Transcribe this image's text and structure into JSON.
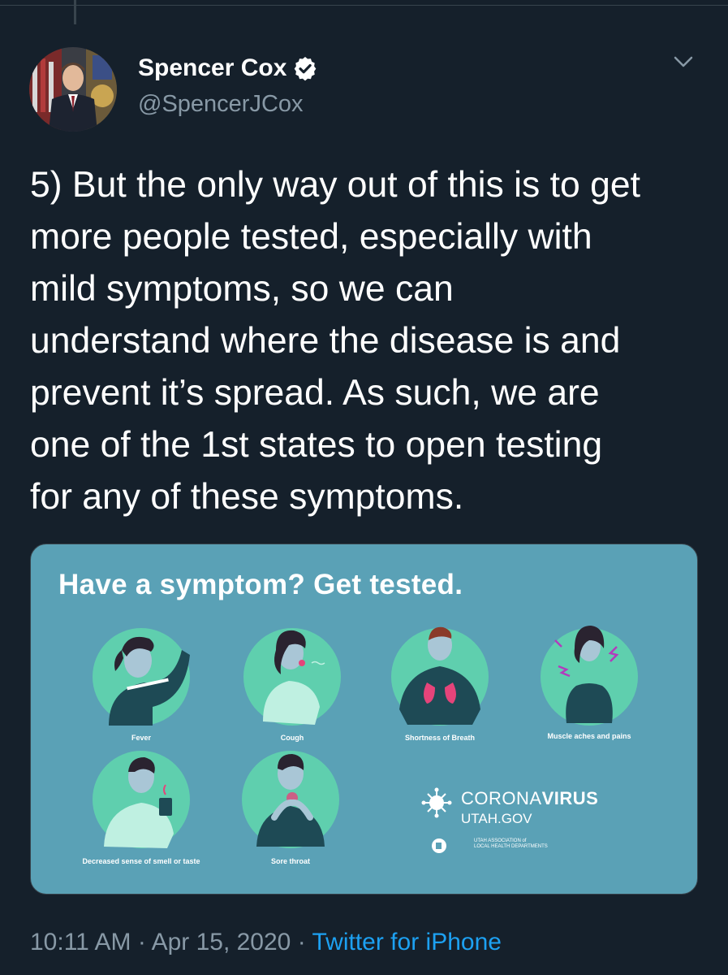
{
  "author": {
    "display_name": "Spencer Cox",
    "handle": "@SpencerJCox",
    "avatar": "avatar-photo",
    "verified_icon": "verified-badge-icon"
  },
  "tweet": {
    "lines": [
      "5) But the only way out of this is to get",
      "more people tested, especially with",
      "mild symptoms, so we can",
      "understand where the disease is and",
      "prevent it’s spread. As such, we are",
      "one of the 1st states to open testing",
      "for any of these symptoms."
    ]
  },
  "media": {
    "headline": "Have a symptom? Get tested.",
    "symptoms": [
      "Fever",
      "Cough",
      "Shortness of Breath",
      "Muscle aches and pains",
      "Decreased sense of smell or taste",
      "Sore throat"
    ],
    "brand_corona_prefix": "CORONA",
    "brand_corona_suffix": "VIRUS",
    "brand_gov": "UTAH.GOV",
    "assoc_line1": "UTAH ASSOCIATION of",
    "assoc_line2": "LOCAL HEALTH DEPARTMENTS",
    "background_color": "#5aa1b6",
    "circle_color": "#5fcfae"
  },
  "meta": {
    "time": "10:11 AM",
    "separator": "·",
    "date": "Apr 15, 2020",
    "source": "Twitter for iPhone"
  },
  "colors": {
    "background": "#15202b",
    "secondary_text": "#8899a6",
    "link": "#1da1f2"
  },
  "icons": {
    "more": "chevron-down-icon"
  }
}
